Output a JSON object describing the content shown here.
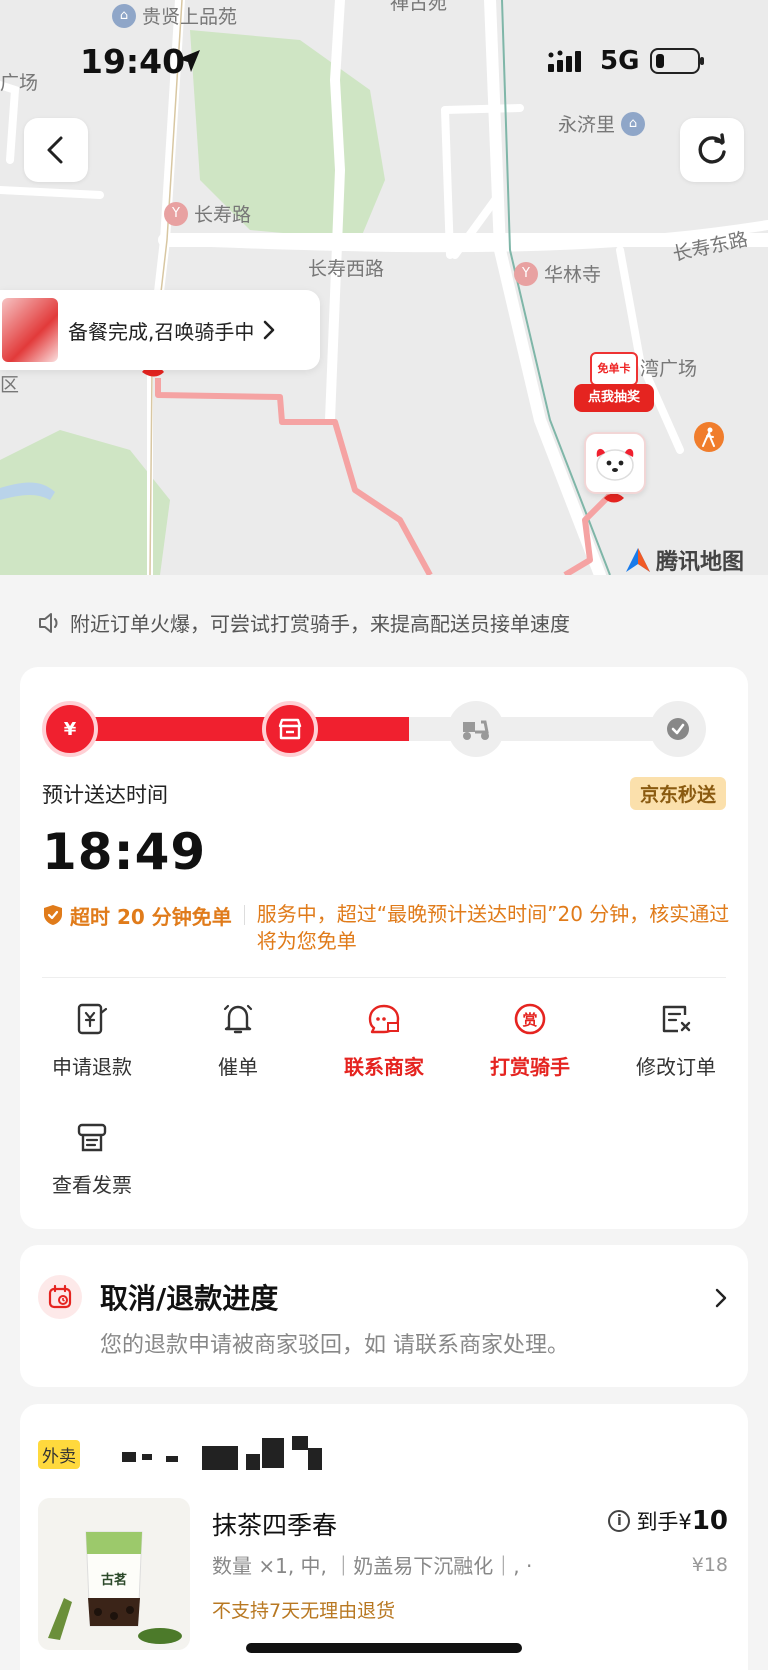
{
  "status_bar": {
    "time": "19:40",
    "network": "5G"
  },
  "map": {
    "labels": {
      "guixian": "贵贤上品苑",
      "top_cut": "禅古苑",
      "guangchang_left": "广场",
      "yongjili": "永济里",
      "changshou_road": "长寿路",
      "changshou_east": "长寿东路",
      "changshou_west": "长寿西路",
      "hualin": "华林寺",
      "wan_guangchang": "湾广场",
      "qu": "区"
    },
    "bubble_text": "备餐完成,召唤骑手中",
    "promo": {
      "top": "免单卡",
      "bottom": "点我抽奖"
    },
    "brand": "腾讯地图"
  },
  "notice": "附近订单火爆，可尝试打赏骑手，来提高配送员接单速度",
  "progress": {
    "fill_fraction": 0.54,
    "eta_label": "预计送达时间",
    "eta_badge": "京东秒送",
    "eta_time": "18:49",
    "guarantee_title": "超时 20 分钟免单",
    "guarantee_desc": "服务中，超过“最晚预计送达时间”20 分钟，核实通过将为您免单",
    "actions": [
      {
        "label": "申请退款",
        "icon": "refund-icon",
        "highlight": false
      },
      {
        "label": "催单",
        "icon": "bell-icon",
        "highlight": false
      },
      {
        "label": "联系商家",
        "icon": "contact-shop-icon",
        "highlight": true
      },
      {
        "label": "打赏骑手",
        "icon": "reward-icon",
        "highlight": true
      },
      {
        "label": "修改订单",
        "icon": "edit-order-icon",
        "highlight": false
      },
      {
        "label": "查看发票",
        "icon": "invoice-icon",
        "highlight": false
      }
    ]
  },
  "refund": {
    "title": "取消/退款进度",
    "desc": "您的退款申请被商家驳回，如      请联系商家处理。"
  },
  "order": {
    "tag": "外卖",
    "product": {
      "name": "抹茶四季春",
      "price_label": "到手¥",
      "price": "10",
      "spec": "数量 ×1, 中, ｜奶盖易下沉融化｜, ·",
      "original_price": "¥18",
      "note": "不支持7天无理由退货",
      "brand_on_cup": "古茗"
    }
  },
  "colors": {
    "accent": "#f0202f",
    "orange": "#e07b1a",
    "badge_bg": "#fbe0ac"
  }
}
